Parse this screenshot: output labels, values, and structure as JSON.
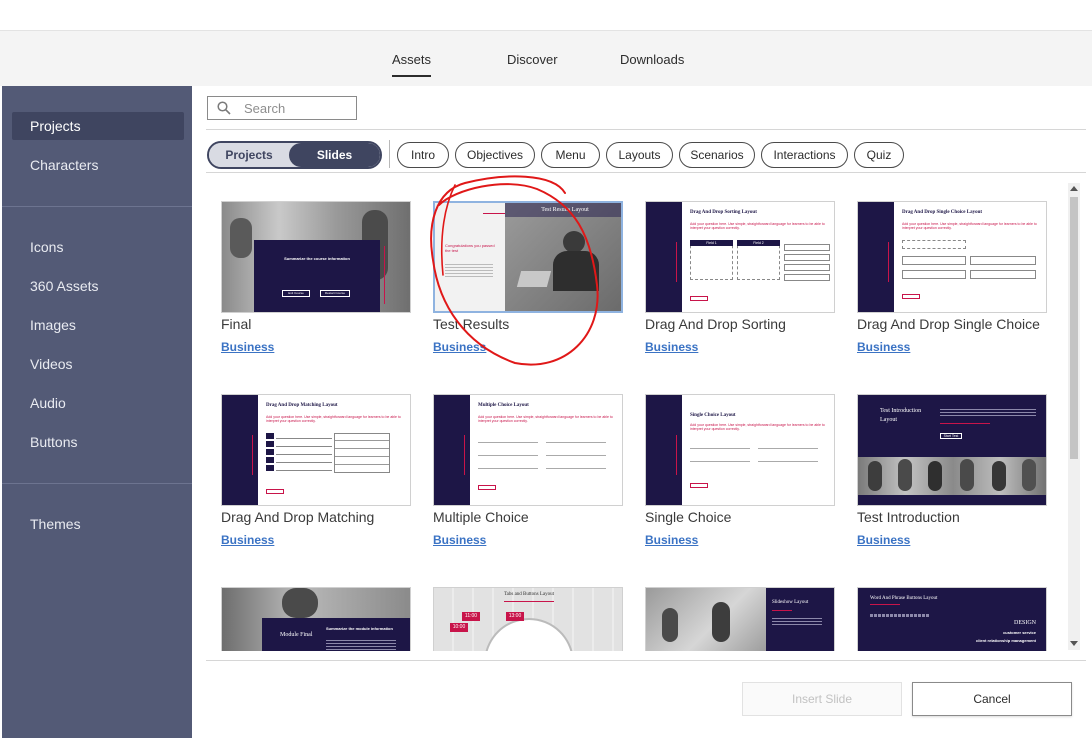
{
  "top_tabs": [
    {
      "label": "Assets",
      "active": true
    },
    {
      "label": "Discover",
      "active": false
    },
    {
      "label": "Downloads",
      "active": false
    }
  ],
  "sidebar": {
    "group1": [
      {
        "label": "Projects",
        "active": true
      },
      {
        "label": "Characters",
        "active": false
      }
    ],
    "group2": [
      {
        "label": "Icons"
      },
      {
        "label": "360 Assets"
      },
      {
        "label": "Images"
      },
      {
        "label": "Videos"
      },
      {
        "label": "Audio"
      },
      {
        "label": "Buttons"
      }
    ],
    "group3": [
      {
        "label": "Themes"
      }
    ]
  },
  "search": {
    "placeholder": "Search"
  },
  "toggle": {
    "projects": "Projects",
    "slides": "Slides",
    "selected": "Slides"
  },
  "filters": [
    "Intro",
    "Objectives",
    "Menu",
    "Layouts",
    "Scenarios",
    "Interactions",
    "Quiz"
  ],
  "cards": [
    {
      "title": "Final",
      "tag": "Business",
      "thumb": {
        "style": "photo-dialog",
        "heading": "Summarize the course information",
        "buttons": [
          "Exit Course",
          "Restart Course"
        ]
      }
    },
    {
      "title": "Test Results",
      "tag": "Business",
      "selected": true,
      "thumb": {
        "style": "results",
        "heading": "Test Results Layout",
        "text": "Congratulations you passed the test"
      }
    },
    {
      "title": "Drag And Drop Sorting",
      "tag": "Business",
      "thumb": {
        "style": "layout",
        "heading": "Drag And Drop Sorting Layout",
        "question": "Add your question here. Use simple, straightforward language for learners to be able to interpret your question correctly.",
        "fields": [
          "Field 1",
          "Field 2"
        ]
      }
    },
    {
      "title": "Drag And Drop Single Choice",
      "tag": "Business",
      "thumb": {
        "style": "layout",
        "heading": "Drag And Drop Single Choice Layout",
        "question": "Add your question here. Use simple, straightforward language for learners to be able to interpret your question correctly."
      }
    },
    {
      "title": "Drag And Drop Matching",
      "tag": "Business",
      "thumb": {
        "style": "layout",
        "heading": "Drag And Drop Matching Layout",
        "question": "Add your question here. Use simple, straightforward language for learners to be able to interpret your question correctly."
      }
    },
    {
      "title": "Multiple Choice",
      "tag": "Business",
      "thumb": {
        "style": "layout",
        "heading": "Multiple Choice Layout",
        "question": "Add your question here. Use simple, straightforward language for learners to be able to interpret your question correctly."
      }
    },
    {
      "title": "Single Choice",
      "tag": "Business",
      "thumb": {
        "style": "layout",
        "heading": "Single Choice Layout",
        "question": "Add your question here. Use simple, straightforward language for learners to be able to interpret your question correctly."
      }
    },
    {
      "title": "Test Introduction",
      "tag": "Business",
      "thumb": {
        "style": "intro",
        "heading": "Test Introduction Layout",
        "button": "Start Test"
      }
    },
    {
      "title": "",
      "tag": "",
      "thumb": {
        "style": "photo-module",
        "heading": "Module Final",
        "text": "Summarize the module information"
      }
    },
    {
      "title": "",
      "tag": "",
      "thumb": {
        "style": "tabs",
        "heading": "Tabs and Buttons Layout",
        "times": [
          "11:00",
          "10:00",
          "13:00"
        ]
      }
    },
    {
      "title": "",
      "tag": "",
      "thumb": {
        "style": "slideshow",
        "heading": "Slideshow Layout"
      }
    },
    {
      "title": "",
      "tag": "",
      "thumb": {
        "style": "words",
        "heading": "Word And Phrase Buttons Layout",
        "words": [
          "DESIGN",
          "customer service",
          "client relationship management"
        ]
      }
    }
  ],
  "buttons": {
    "insert": "Insert Slide",
    "cancel": "Cancel"
  },
  "colors": {
    "sidebar": "#535a76",
    "navy": "#1d1646",
    "accent": "#c8144a",
    "link": "#3b73c4",
    "annotation": "#e01818"
  }
}
